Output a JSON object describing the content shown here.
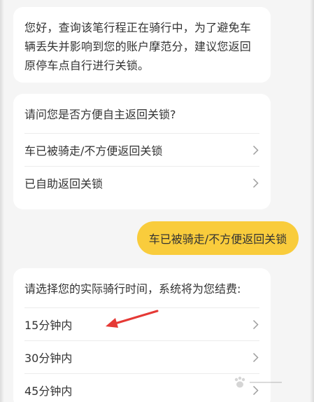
{
  "chat": {
    "notice": {
      "lines": [
        "您好，查询该笔行程正在骑行中，为了避免车",
        "辆丢失并影响到您的账户摩范分，建议您返回",
        "原停车点自行进行关锁。"
      ]
    },
    "question1": {
      "title": "请问您是否方便自主返回关锁?",
      "options": [
        {
          "label": "车已被骑走/不方便返回关锁"
        },
        {
          "label": "已自助返回关锁"
        }
      ]
    },
    "user_reply": {
      "text": "车已被骑走/不方便返回关锁"
    },
    "question2": {
      "title": "请选择您的实际骑行时间，系统将为您结费:",
      "options": [
        {
          "label": "15分钟内"
        },
        {
          "label": "30分钟内"
        },
        {
          "label": "45分钟内"
        }
      ]
    }
  },
  "colors": {
    "page_background": "#f5f5f5",
    "card_background": "#ffffff",
    "user_bubble": "#f9cc3c",
    "annotation_arrow": "#e53935",
    "chevron": "#9e9e9e"
  },
  "icons": {
    "option_chevron": "chevron-right-icon",
    "annotation": "red-arrow-icon",
    "watermark": "baidu-paw-icon"
  }
}
